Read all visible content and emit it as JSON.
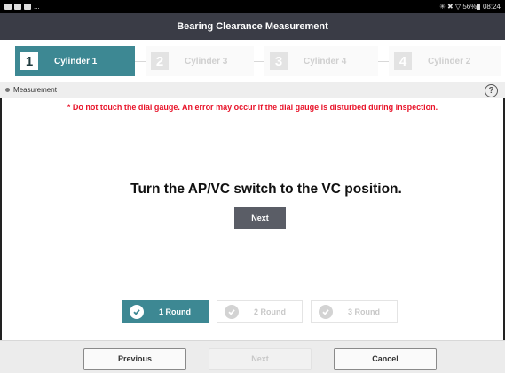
{
  "status_bar": {
    "right_text": "✳ ✖ ▽ 56%▮ 08:24",
    "dots": "..."
  },
  "title": "Bearing Clearance Measurement",
  "steps": [
    {
      "number": "1",
      "label": "Cylinder 1",
      "active": true
    },
    {
      "number": "2",
      "label": "Cylinder 3",
      "active": false
    },
    {
      "number": "3",
      "label": "Cylinder 4",
      "active": false
    },
    {
      "number": "4",
      "label": "Cylinder 2",
      "active": false
    }
  ],
  "measurement_bar": {
    "label": "Measurement",
    "help_symbol": "?"
  },
  "warning": "* Do not touch the dial gauge. An error may occur if the dial gauge is disturbed during inspection.",
  "instruction": "Turn the AP/VC switch to the VC position.",
  "next_button_label": "Next",
  "rounds": [
    {
      "label": "1 Round",
      "active": true
    },
    {
      "label": "2 Round",
      "active": false
    },
    {
      "label": "3 Round",
      "active": false
    }
  ],
  "footer": {
    "previous_label": "Previous",
    "next_label": "Next",
    "cancel_label": "Cancel"
  },
  "colors": {
    "accent": "#3d8893",
    "title_bar": "#3a3c46",
    "warning": "#e8142a"
  }
}
